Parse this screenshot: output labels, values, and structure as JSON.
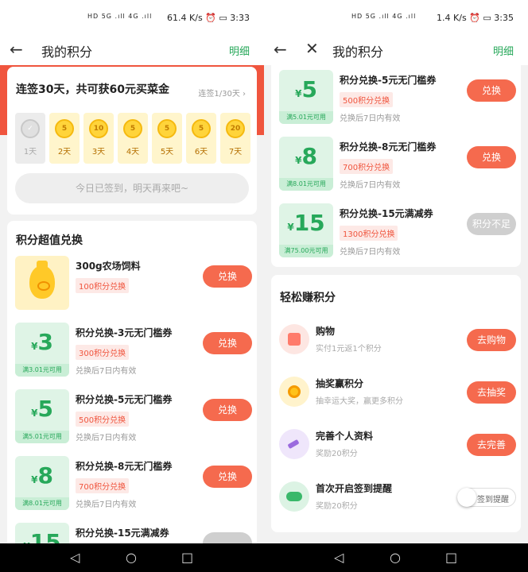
{
  "left": {
    "status": {
      "signal": "HD 5G .ıll 4G .ıll",
      "speed": "61.4 K/s",
      "time": "3:33"
    },
    "nav": {
      "title": "我的积分",
      "detail": "明细"
    },
    "sign": {
      "title": "连签30天，共可获60元买菜金",
      "progress": "连签1/30天 ›",
      "days": [
        {
          "coin": "✓",
          "label": "1天"
        },
        {
          "coin": "5",
          "label": "2天"
        },
        {
          "coin": "10",
          "label": "3天"
        },
        {
          "coin": "5",
          "label": "4天"
        },
        {
          "coin": "5",
          "label": "5天"
        },
        {
          "coin": "5",
          "label": "6天"
        },
        {
          "coin": "20",
          "label": "7天"
        }
      ],
      "button": "今日已签到，明天再来吧~"
    },
    "exchange": {
      "title": "积分超值兑换",
      "items": [
        {
          "name": "300g农场饲料",
          "tag": "100积分兑换",
          "button": "兑换"
        },
        {
          "amount": "3",
          "currency": "¥",
          "cond": "满3.01元可用",
          "name": "积分兑换-3元无门槛券",
          "tag": "300积分兑换",
          "valid": "兑换后7日内有效",
          "button": "兑换"
        },
        {
          "amount": "5",
          "currency": "¥",
          "cond": "满5.01元可用",
          "name": "积分兑换-5元无门槛券",
          "tag": "500积分兑换",
          "valid": "兑换后7日内有效",
          "button": "兑换"
        },
        {
          "amount": "8",
          "currency": "¥",
          "cond": "满8.01元可用",
          "name": "积分兑换-8元无门槛券",
          "tag": "700积分兑换",
          "valid": "兑换后7日内有效",
          "button": "兑换"
        },
        {
          "amount": "15",
          "currency": "¥",
          "name": "积分兑换-15元满减券"
        }
      ]
    }
  },
  "right": {
    "status": {
      "signal": "HD 5G .ıll 4G .ıll",
      "speed": "1.4 K/s",
      "time": "3:35"
    },
    "nav": {
      "title": "我的积分",
      "detail": "明细"
    },
    "exchange": {
      "items": [
        {
          "amount": "5",
          "currency": "¥",
          "cond": "满5.01元可用",
          "name": "积分兑换-5元无门槛券",
          "tag": "500积分兑换",
          "valid": "兑换后7日内有效",
          "button": "兑换"
        },
        {
          "amount": "8",
          "currency": "¥",
          "cond": "满8.01元可用",
          "name": "积分兑换-8元无门槛券",
          "tag": "700积分兑换",
          "valid": "兑换后7日内有效",
          "button": "兑换"
        },
        {
          "amount": "15",
          "currency": "¥",
          "cond": "满75.00元可用",
          "name": "积分兑换-15元满减券",
          "tag": "1300积分兑换",
          "valid": "兑换后7日内有效",
          "button": "积分不足"
        }
      ]
    },
    "earn": {
      "title": "轻松赚积分",
      "tasks": [
        {
          "name": "购物",
          "desc": "实付1元返1个积分",
          "button": "去购物"
        },
        {
          "name": "抽奖赢积分",
          "desc": "抽幸运大奖，赢更多积分",
          "button": "去抽奖"
        },
        {
          "name": "完善个人资料",
          "desc": "奖励20积分",
          "button": "去完善"
        },
        {
          "name": "首次开启签到提醒",
          "desc": "奖励20积分",
          "toggle": "签到提醒"
        }
      ]
    }
  },
  "sysnav": {
    "back": "◁",
    "home": "○",
    "recent": "□"
  },
  "colors": {
    "accent": "#f56a4e",
    "green": "#27a85a",
    "banner": "#f0553e"
  }
}
